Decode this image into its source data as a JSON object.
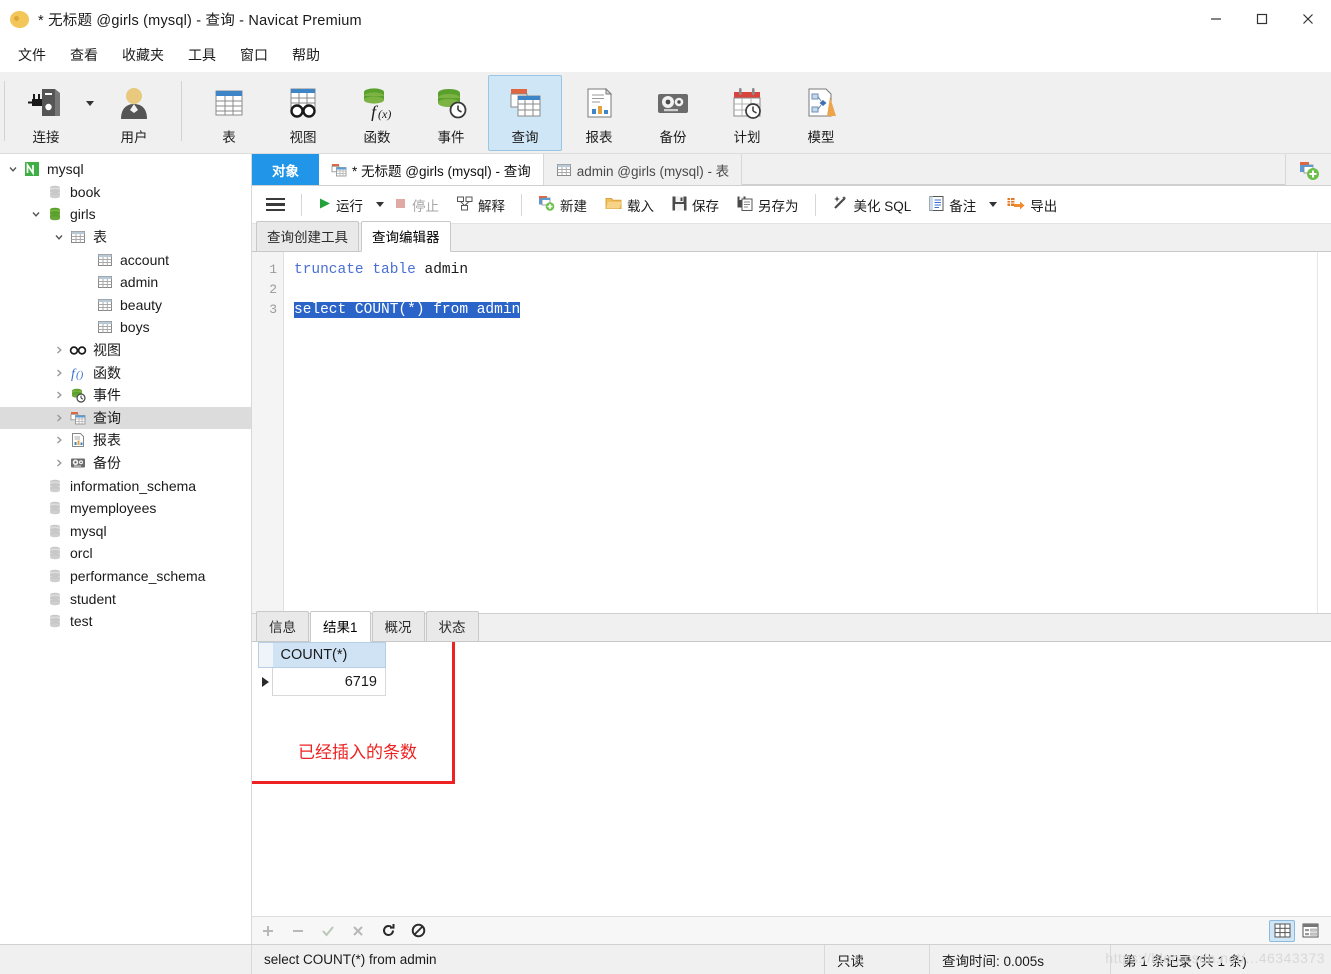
{
  "window": {
    "title": "* 无标题 @girls (mysql) - 查询 - Navicat Premium",
    "minimize_label": "最小化",
    "maximize_label": "最大化",
    "close_label": "关闭"
  },
  "menubar": {
    "items": [
      {
        "label": "文件"
      },
      {
        "label": "查看"
      },
      {
        "label": "收藏夹"
      },
      {
        "label": "工具"
      },
      {
        "label": "窗口"
      },
      {
        "label": "帮助"
      }
    ]
  },
  "toolbar": {
    "groups": [
      {
        "buttons": [
          {
            "label": "连接",
            "icon": "connection-icon",
            "has_dropdown": true
          },
          {
            "label": "用户",
            "icon": "user-icon",
            "has_dropdown": false
          }
        ]
      },
      {
        "buttons": [
          {
            "label": "表",
            "icon": "table-icon",
            "active": false
          },
          {
            "label": "视图",
            "icon": "view-icon",
            "active": false
          },
          {
            "label": "函数",
            "icon": "function-icon",
            "active": false
          },
          {
            "label": "事件",
            "icon": "event-icon",
            "active": false
          },
          {
            "label": "查询",
            "icon": "query-icon",
            "active": true
          },
          {
            "label": "报表",
            "icon": "report-icon",
            "active": false
          },
          {
            "label": "备份",
            "icon": "backup-icon",
            "active": false
          },
          {
            "label": "计划",
            "icon": "schedule-icon",
            "active": false
          },
          {
            "label": "模型",
            "icon": "model-icon",
            "active": false
          }
        ]
      }
    ]
  },
  "sidebar": {
    "nodes": [
      {
        "label": "mysql",
        "indent": 0,
        "twisty": "down",
        "icon": "navicat-connection-icon",
        "selected": false
      },
      {
        "label": "book",
        "indent": 1,
        "twisty": "none",
        "icon": "database-gray-icon",
        "selected": false
      },
      {
        "label": "girls",
        "indent": 1,
        "twisty": "down",
        "icon": "database-green-icon",
        "selected": false
      },
      {
        "label": "表",
        "indent": 2,
        "twisty": "down",
        "icon": "table-icon",
        "selected": false
      },
      {
        "label": "account",
        "indent": 3,
        "twisty": "none",
        "icon": "table-icon",
        "selected": false
      },
      {
        "label": "admin",
        "indent": 3,
        "twisty": "none",
        "icon": "table-icon",
        "selected": false
      },
      {
        "label": "beauty",
        "indent": 3,
        "twisty": "none",
        "icon": "table-icon",
        "selected": false
      },
      {
        "label": "boys",
        "indent": 3,
        "twisty": "none",
        "icon": "table-icon",
        "selected": false
      },
      {
        "label": "视图",
        "indent": 2,
        "twisty": "right",
        "icon": "view-icon",
        "selected": false
      },
      {
        "label": "函数",
        "indent": 2,
        "twisty": "right",
        "icon": "function-icon",
        "selected": false
      },
      {
        "label": "事件",
        "indent": 2,
        "twisty": "right",
        "icon": "event-icon",
        "selected": false
      },
      {
        "label": "查询",
        "indent": 2,
        "twisty": "right",
        "icon": "query-icon",
        "selected": true
      },
      {
        "label": "报表",
        "indent": 2,
        "twisty": "right",
        "icon": "report-icon",
        "selected": false
      },
      {
        "label": "备份",
        "indent": 2,
        "twisty": "right",
        "icon": "backup-icon",
        "selected": false
      },
      {
        "label": "information_schema",
        "indent": 1,
        "twisty": "none",
        "icon": "database-gray-icon",
        "selected": false
      },
      {
        "label": "myemployees",
        "indent": 1,
        "twisty": "none",
        "icon": "database-gray-icon",
        "selected": false
      },
      {
        "label": "mysql",
        "indent": 1,
        "twisty": "none",
        "icon": "database-gray-icon",
        "selected": false
      },
      {
        "label": "orcl",
        "indent": 1,
        "twisty": "none",
        "icon": "database-gray-icon",
        "selected": false
      },
      {
        "label": "performance_schema",
        "indent": 1,
        "twisty": "none",
        "icon": "database-gray-icon",
        "selected": false
      },
      {
        "label": "student",
        "indent": 1,
        "twisty": "none",
        "icon": "database-gray-icon",
        "selected": false
      },
      {
        "label": "test",
        "indent": 1,
        "twisty": "none",
        "icon": "database-gray-icon",
        "selected": false
      }
    ]
  },
  "tabstrip": {
    "object_tab": "对象",
    "tabs": [
      {
        "label": "* 无标题 @girls (mysql) - 查询",
        "icon": "query-icon",
        "active": true
      },
      {
        "label": "admin @girls (mysql) - 表",
        "icon": "table-icon",
        "active": false
      }
    ],
    "new_tab_label": "新建查询"
  },
  "query_toolbar": {
    "menu_label": "菜单",
    "buttons": [
      {
        "label": "运行",
        "icon": "play-icon",
        "disabled": false,
        "dropdown": true
      },
      {
        "label": "停止",
        "icon": "stop-icon",
        "disabled": true,
        "dropdown": false
      },
      {
        "label": "解释",
        "icon": "explain-icon",
        "disabled": false,
        "dropdown": false
      },
      {
        "label": "新建",
        "icon": "new-query-icon",
        "disabled": false,
        "dropdown": false
      },
      {
        "label": "载入",
        "icon": "folder-icon",
        "disabled": false,
        "dropdown": false
      },
      {
        "label": "保存",
        "icon": "save-icon",
        "disabled": false,
        "dropdown": false
      },
      {
        "label": "另存为",
        "icon": "save-as-icon",
        "disabled": false,
        "dropdown": false
      },
      {
        "label": "美化 SQL",
        "icon": "wand-icon",
        "disabled": false,
        "dropdown": false
      },
      {
        "label": "备注",
        "icon": "note-icon",
        "disabled": false,
        "dropdown": true
      },
      {
        "label": "导出",
        "icon": "export-icon",
        "disabled": false,
        "dropdown": false
      }
    ]
  },
  "editor": {
    "subtabs": [
      {
        "label": "查询创建工具",
        "active": false
      },
      {
        "label": "查询编辑器",
        "active": true
      }
    ],
    "lines": [
      {
        "num": "1",
        "segments": [
          {
            "text": "truncate table ",
            "type": "keyword"
          },
          {
            "text": "admin",
            "type": "plain"
          }
        ],
        "selected": false
      },
      {
        "num": "2",
        "segments": [
          {
            "text": "",
            "type": "plain"
          }
        ],
        "selected": false
      },
      {
        "num": "3",
        "segments": [
          {
            "text": "select COUNT(*) from admin",
            "type": "plain"
          }
        ],
        "selected": true
      }
    ]
  },
  "results": {
    "tabs": [
      {
        "label": "信息",
        "active": false
      },
      {
        "label": "结果1",
        "active": true
      },
      {
        "label": "概况",
        "active": false
      },
      {
        "label": "状态",
        "active": false
      }
    ],
    "grid": {
      "columns": [
        "COUNT(*)"
      ],
      "rows": [
        {
          "current": true,
          "cells": [
            "6719"
          ]
        }
      ]
    },
    "annotation": {
      "text": "已经插入的条数",
      "color": "#ee2222"
    }
  },
  "grid_toolbar": {
    "icons": [
      {
        "name": "add-record-icon",
        "glyph": "+",
        "disabled": true
      },
      {
        "name": "remove-record-icon",
        "glyph": "−",
        "disabled": true
      },
      {
        "name": "apply-change-icon",
        "glyph": "✓",
        "disabled": true
      },
      {
        "name": "cancel-change-icon",
        "glyph": "✕",
        "disabled": true
      },
      {
        "name": "refresh-icon",
        "glyph": "⟳",
        "disabled": false
      },
      {
        "name": "stop-icon",
        "glyph": "⊘",
        "disabled": false
      }
    ],
    "view_modes": [
      {
        "name": "grid-view",
        "active": true
      },
      {
        "name": "form-view",
        "active": false
      }
    ]
  },
  "statusbar": {
    "query_text": "select COUNT(*) from admin",
    "readonly": "只读",
    "query_time": "查询时间: 0.005s",
    "record_info": "第 1 条记录 (共 1 条)",
    "watermark": "https://blog.csdn.net/...46343373"
  }
}
